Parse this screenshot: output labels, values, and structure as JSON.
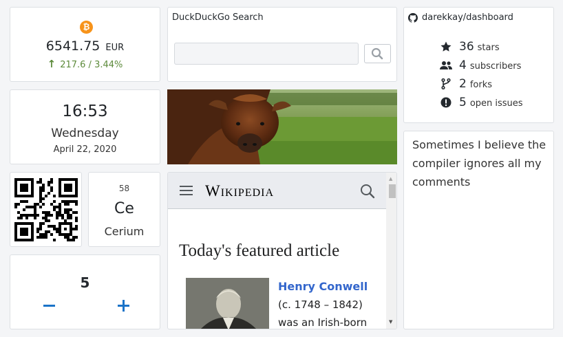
{
  "bitcoin": {
    "icon": "bitcoin-icon",
    "symbol": "₿",
    "price": "6541.75",
    "currency": "EUR",
    "change": "217.6 / 3.44%",
    "change_color": "#5c8a3a"
  },
  "ddg": {
    "title": "DuckDuckGo Search",
    "query": "",
    "placeholder": ""
  },
  "github": {
    "repo": "darekkay/dashboard",
    "stats": [
      {
        "icon": "star-icon",
        "value": "36",
        "label": "stars"
      },
      {
        "icon": "users-icon",
        "value": "4",
        "label": "subscribers"
      },
      {
        "icon": "fork-icon",
        "value": "2",
        "label": "forks"
      },
      {
        "icon": "alert-icon",
        "value": "5",
        "label": "open issues"
      }
    ]
  },
  "clock": {
    "time": "16:53",
    "weekday": "Wednesday",
    "date": "April 22, 2020"
  },
  "quote": {
    "text": "Sometimes I believe the compiler ignores all my comments"
  },
  "element": {
    "number": "58",
    "symbol": "Ce",
    "name": "Cerium"
  },
  "counter": {
    "value": "5",
    "accent": "#1a73c8"
  },
  "wikipedia": {
    "logo": "Wikipedia",
    "heading": "Today's featured article",
    "article_title": "Henry Conwell",
    "article_dates": "(c. 1748 – 1842)",
    "article_desc": "was an Irish-born"
  }
}
